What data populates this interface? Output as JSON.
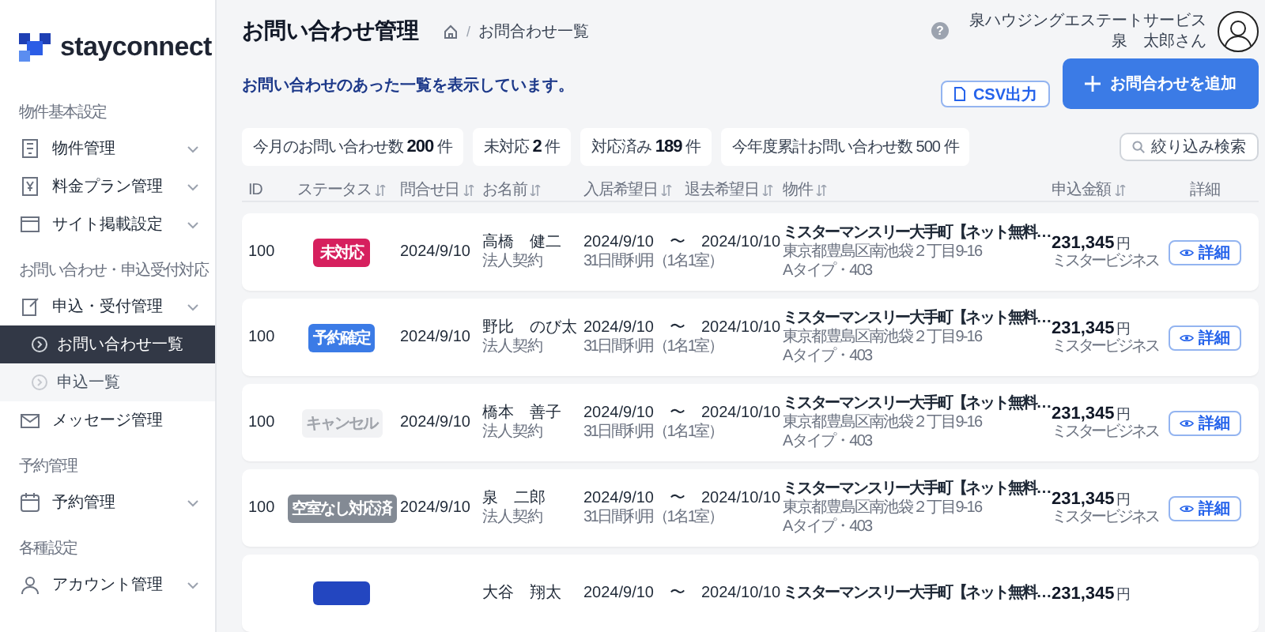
{
  "sidebar": {
    "logo": "stayconnect",
    "sections": [
      {
        "label": "物件基本設定",
        "items": [
          {
            "label": "物件管理",
            "has_submenu": true,
            "selected": false
          },
          {
            "label": "料金プラン管理",
            "has_submenu": true,
            "selected": false
          },
          {
            "label": "サイト掲載設定",
            "has_submenu": true,
            "selected": false
          }
        ]
      },
      {
        "label": "お問い合わせ・申込受付対応",
        "items": [
          {
            "label": "申込・受付管理",
            "has_submenu": true,
            "selected": false,
            "children": [
              {
                "label": "お問い合わせ一覧",
                "selected": true
              },
              {
                "label": "申込一覧",
                "selected": false
              }
            ]
          },
          {
            "label": "メッセージ管理",
            "has_submenu": false,
            "selected": false
          }
        ]
      },
      {
        "label": "予約管理",
        "items": [
          {
            "label": "予約管理",
            "has_submenu": true,
            "selected": false
          }
        ]
      },
      {
        "label": "各種設定",
        "items": [
          {
            "label": "アカウント管理",
            "has_submenu": true,
            "selected": false
          }
        ]
      }
    ]
  },
  "header": {
    "title": "お問い合わせ管理",
    "breadcrumb_separator": "/",
    "breadcrumb": [
      "お問合わせ一覧"
    ],
    "help": "?",
    "company": "泉ハウジングエステートサービス",
    "user": "泉　太郎さん"
  },
  "description": "お問い合わせのあった一覧を表示しています。",
  "buttons": {
    "csv": "CSV出力",
    "add": "お問合わせを追加",
    "filter": "絞り込み検索"
  },
  "stats": [
    "今月のお問い合わせ数 **200** 件",
    "未対応 **2** 件",
    "対応済み **189** 件",
    "今年度累計お問い合わせ数 500 件"
  ],
  "table": {
    "columns": [
      {
        "label": "ID",
        "sortable": false
      },
      {
        "label": "ステータス",
        "sortable": true
      },
      {
        "label": "問合せ日",
        "sortable": true
      },
      {
        "label": "お名前",
        "sortable": true
      },
      {
        "kind": "pair",
        "items": [
          {
            "label": "入居希望日",
            "sortable": true
          },
          {
            "label": "退去希望日",
            "sortable": true
          }
        ]
      },
      {
        "label": "物件",
        "sortable": true
      },
      {
        "label": "申込金額",
        "sortable": true
      },
      {
        "label": "詳細",
        "sortable": false
      }
    ],
    "rows": [
      {
        "id": "100",
        "status": {
          "label": "未対応",
          "color": "#d6205e"
        },
        "date": "2024/9/10",
        "name": "高橋　健二",
        "contract": "法人契約",
        "stay": "2024/9/10　〜　2024/10/10",
        "stay_note": "31日間利用（1名1室）",
        "property": "ミスターマンスリー大手町【ネット無料…",
        "address": "東京都豊島区南池袋２丁目9-16",
        "unit": "Aタイプ・403",
        "amount": "231,345",
        "currency": "円",
        "agent": "ミスタービジネス",
        "detail": "詳細"
      },
      {
        "id": "100",
        "status": {
          "label": "予約確定",
          "color": "#3b7be6"
        },
        "date": "2024/9/10",
        "name": "野比　のび太",
        "contract": "法人契約",
        "stay": "2024/9/10　〜　2024/10/10",
        "stay_note": "31日間利用（1名1室）",
        "property": "ミスターマンスリー大手町【ネット無料…",
        "address": "東京都豊島区南池袋２丁目9-16",
        "unit": "Aタイプ・403",
        "amount": "231,345",
        "currency": "円",
        "agent": "ミスタービジネス",
        "detail": "詳細"
      },
      {
        "id": "100",
        "status": {
          "label": "キャンセル",
          "color": "#f1f2f4"
        },
        "date": "2024/9/10",
        "name": "橋本　善子",
        "contract": "法人契約",
        "stay": "2024/9/10　〜　2024/10/10",
        "stay_note": "31日間利用（1名1室）",
        "property": "ミスターマンスリー大手町【ネット無料…",
        "address": "東京都豊島区南池袋２丁目9-16",
        "unit": "Aタイプ・403",
        "amount": "231,345",
        "currency": "円",
        "agent": "ミスタービジネス",
        "detail": "詳細"
      },
      {
        "id": "100",
        "status": {
          "label": "空室なし対応済",
          "color": "#838a94"
        },
        "date": "2024/9/10",
        "name": "泉　二郎",
        "contract": "法人契約",
        "stay": "2024/9/10　〜　2024/10/10",
        "stay_note": "31日間利用（1名1室）",
        "property": "ミスターマンスリー大手町【ネット無料…",
        "address": "東京都豊島区南池袋２丁目9-16",
        "unit": "Aタイプ・403",
        "amount": "231,345",
        "currency": "円",
        "agent": "ミスタービジネス",
        "detail": "詳細"
      },
      {
        "status": {
          "color": "#2346c0"
        },
        "name": "大谷　翔太",
        "stay": "2024/9/10　〜　2024/10/10",
        "property": "ミスターマンスリー大手町【ネット無料…",
        "amount": "231,345",
        "currency": "円"
      }
    ]
  }
}
